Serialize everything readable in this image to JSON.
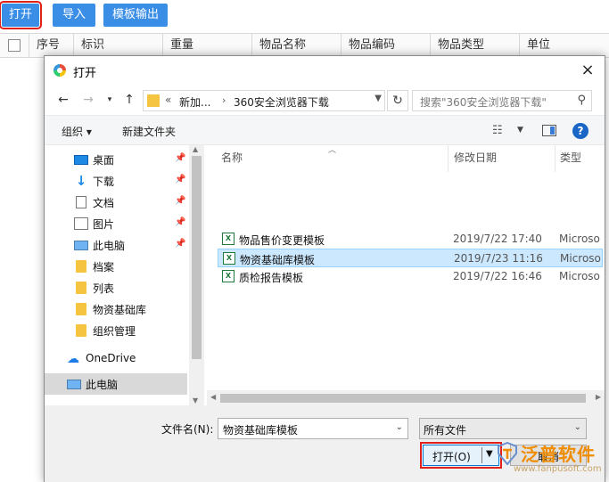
{
  "app": {
    "toolbar": {
      "open": "打开",
      "import": "导入",
      "export": "模板输出"
    },
    "columns": [
      "序号",
      "标识",
      "重量",
      "物品名称",
      "物品编码",
      "物品类型",
      "单位"
    ]
  },
  "dialog": {
    "title": "打开",
    "close": "×",
    "address": {
      "overflow": "«",
      "segments": [
        "新加...",
        "360安全浏览器下载"
      ],
      "separator": "›"
    },
    "search_placeholder": "搜索\"360安全浏览器下载\"",
    "commands": {
      "organize": "组织 ▾",
      "new_folder": "新建文件夹"
    },
    "nav_items": [
      {
        "label": "桌面",
        "icon": "desktop-icon",
        "pinned": true
      },
      {
        "label": "下载",
        "icon": "download-icon",
        "pinned": true
      },
      {
        "label": "文档",
        "icon": "document-icon",
        "pinned": true
      },
      {
        "label": "图片",
        "icon": "picture-icon",
        "pinned": true
      },
      {
        "label": "此电脑",
        "icon": "computer-icon",
        "pinned": true
      },
      {
        "label": "档案",
        "icon": "folder-icon"
      },
      {
        "label": "列表",
        "icon": "folder-icon"
      },
      {
        "label": "物资基础库",
        "icon": "folder-icon"
      },
      {
        "label": "组织管理",
        "icon": "folder-icon"
      },
      {
        "label": "OneDrive",
        "icon": "cloud-icon"
      },
      {
        "label": "此电脑",
        "icon": "computer-icon",
        "selected": true
      }
    ],
    "file_columns": {
      "name": "名称",
      "date": "修改日期",
      "type": "类型"
    },
    "files": [
      {
        "name": "物品售价变更模板",
        "date": "2019/7/22 17:40",
        "type": "Microso"
      },
      {
        "name": "物资基础库模板",
        "date": "2019/7/23 11:16",
        "type": "Microso",
        "selected": true
      },
      {
        "name": "质检报告模板",
        "date": "2019/7/22 16:46",
        "type": "Microso"
      }
    ],
    "filename_label": "文件名(N):",
    "filename_value": "物资基础库模板",
    "filetype_value": "所有文件",
    "open_button": "打开(O)",
    "cancel_button": "取消"
  },
  "watermark": {
    "brand": "泛普软件",
    "url": "www.fanpusoft.com"
  },
  "colors": {
    "accent": "#3a8ee6",
    "highlight": "#e0211b",
    "selection": "#cce8ff",
    "brand": "#f08c00"
  }
}
